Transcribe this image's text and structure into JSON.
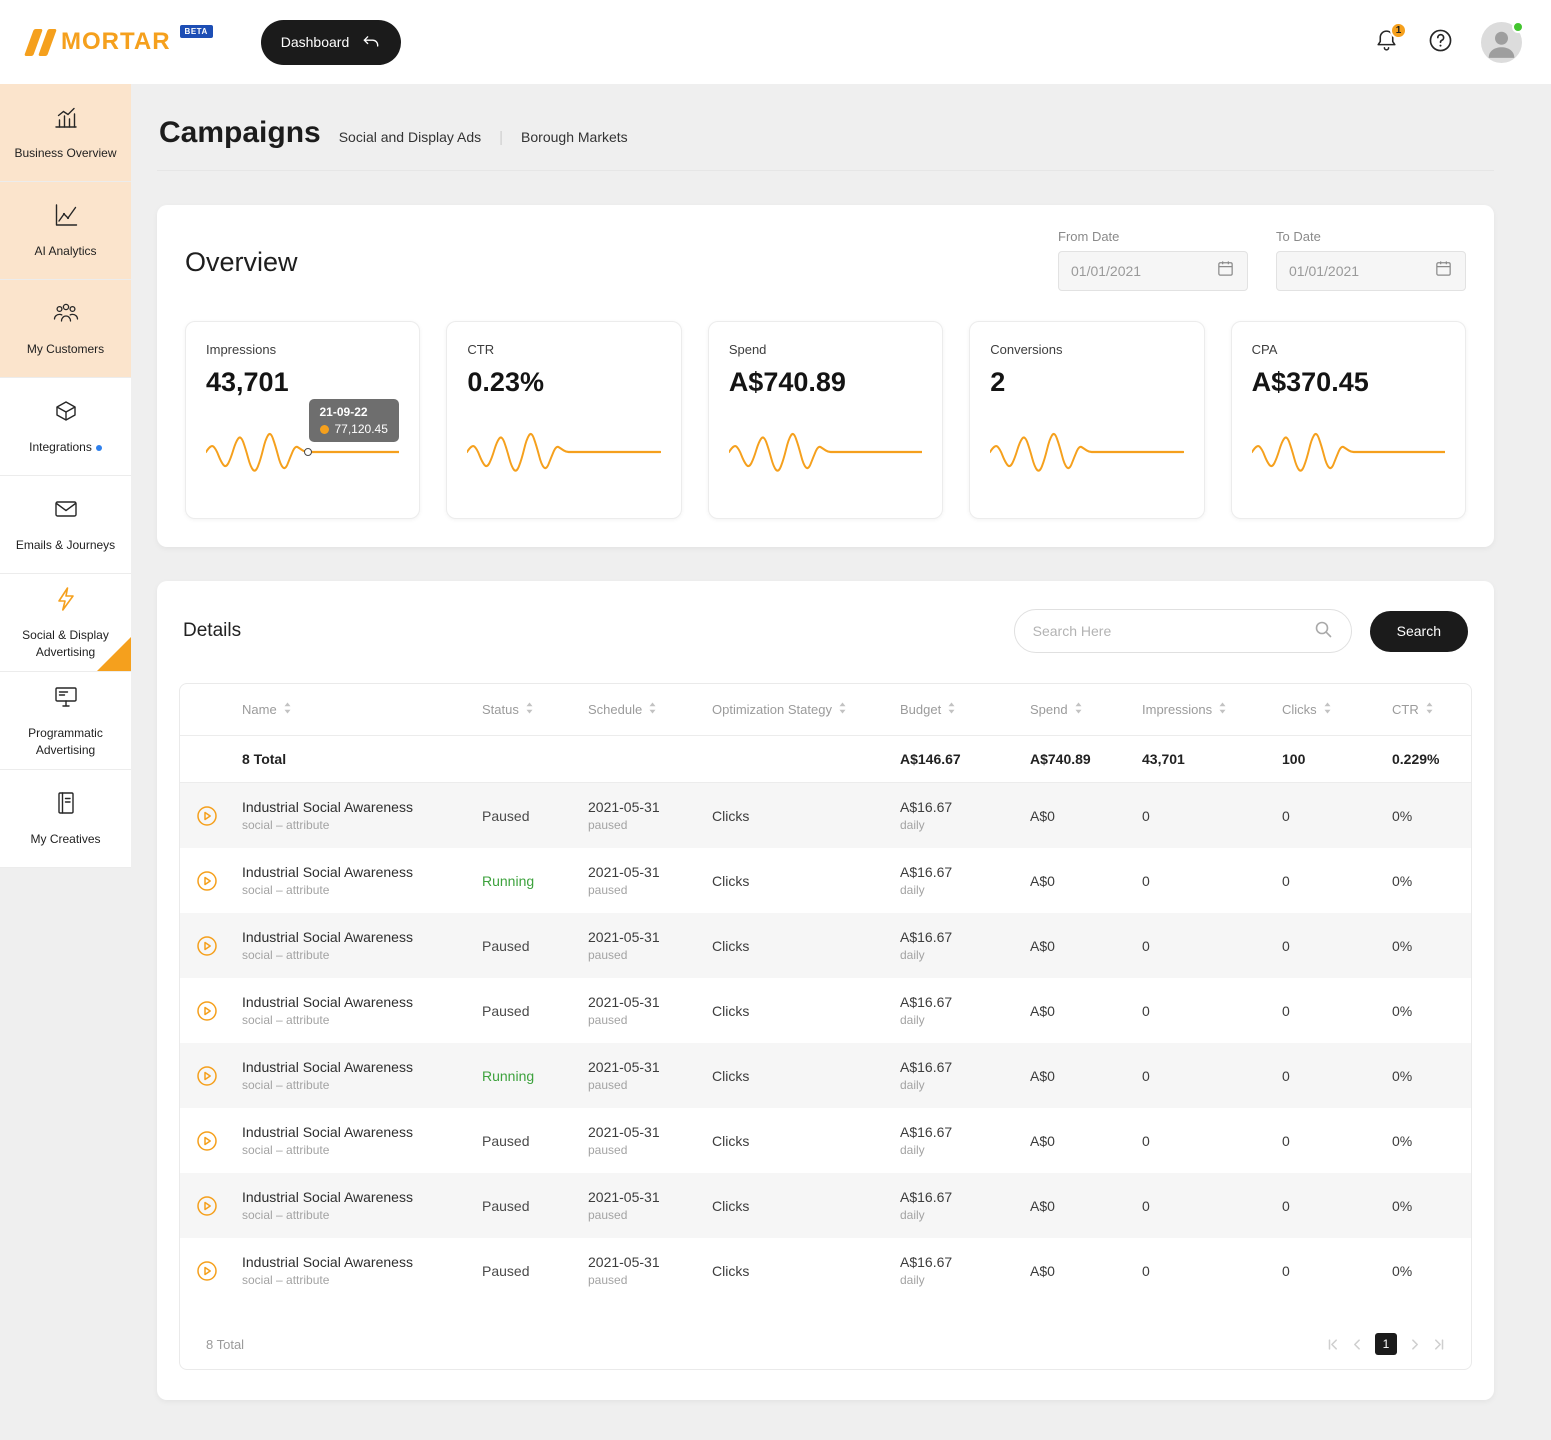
{
  "theme": {
    "accent_orange": "#F5A01D",
    "peach_highlight": "#FBE4CC",
    "beta_blue": "#1D4EB5",
    "running_green": "#3DA23D",
    "page_background": "#EFEFEF",
    "button_black": "#1B1B1B"
  },
  "brand": {
    "name": "MORTAR",
    "beta": "BETA",
    "logo_icon": "mortar-slashes-icon"
  },
  "topbar": {
    "dashboard_label": "Dashboard",
    "dashboard_icon": "reply-arrow-icon",
    "notification_count": "1",
    "icons": [
      "bell-icon",
      "help-icon",
      "avatar"
    ]
  },
  "sidebar": {
    "items": [
      {
        "id": "business-overview",
        "label": "Business Overview",
        "icon": "bar-chart-icon",
        "highlight": true
      },
      {
        "id": "ai-analytics",
        "label": "AI Analytics",
        "icon": "line-chart-icon",
        "highlight": true
      },
      {
        "id": "my-customers",
        "label": "My Customers",
        "icon": "customers-icon",
        "highlight": true
      },
      {
        "id": "integrations",
        "label": "Integrations",
        "icon": "integrations-icon",
        "dot": true
      },
      {
        "id": "emails-journeys",
        "label": "Emails & Journeys",
        "icon": "envelope-icon"
      },
      {
        "id": "social-display-advertising",
        "label": "Social & Display Advertising",
        "icon": "lightning-icon",
        "active": true
      },
      {
        "id": "programmatic-advertising",
        "label": "Programmatic Advertising",
        "icon": "monitor-icon"
      },
      {
        "id": "my-creatives",
        "label": "My Creatives",
        "icon": "notebook-icon"
      }
    ]
  },
  "page": {
    "title": "Campaigns",
    "breadcrumbs": [
      "Social and Display Ads",
      "Borough Markets"
    ]
  },
  "overview": {
    "title": "Overview",
    "from_date": {
      "label": "From Date",
      "value": "01/01/2021"
    },
    "to_date": {
      "label": "To Date",
      "value": "01/01/2021"
    },
    "metrics": [
      {
        "id": "impressions",
        "label": "Impressions",
        "value": "43,701"
      },
      {
        "id": "ctr",
        "label": "CTR",
        "value": "0.23%"
      },
      {
        "id": "spend",
        "label": "Spend",
        "value": "A$740.89"
      },
      {
        "id": "conversions",
        "label": "Conversions",
        "value": "2"
      },
      {
        "id": "cpa",
        "label": "CPA",
        "value": "A$370.45"
      }
    ],
    "tooltip": {
      "date": "21-09-22",
      "value": "77,120.45"
    },
    "sparkline": [
      0.5,
      0.62,
      0.55,
      0.35,
      0.25,
      0.4,
      0.66,
      0.76,
      0.55,
      0.26,
      0.18,
      0.38,
      0.7,
      0.82,
      0.6,
      0.3,
      0.22,
      0.42,
      0.6,
      0.55,
      0.5,
      0.5,
      0.5,
      0.5,
      0.5,
      0.5,
      0.5,
      0.5,
      0.5,
      0.5,
      0.5,
      0.5,
      0.5,
      0.5,
      0.5,
      0.5,
      0.5,
      0.5,
      0.5,
      0.5
    ]
  },
  "details": {
    "title": "Details",
    "search_placeholder": "Search Here",
    "search_button": "Search",
    "table": {
      "columns": [
        "Name",
        "Status",
        "Schedule",
        "Optimization Stategy",
        "Budget",
        "Spend",
        "Impressions",
        "Clicks",
        "CTR"
      ],
      "totals": {
        "label": "8 Total",
        "budget": "A$146.67",
        "spend": "A$740.89",
        "impressions": "43,701",
        "clicks": "100",
        "ctr": "0.229%"
      },
      "rows": [
        {
          "name": "Industrial Social Awareness",
          "subtitle": "social – attribute",
          "status": "Paused",
          "schedule": "2021-05-31",
          "schedule_note": "paused",
          "strategy": "Clicks",
          "budget": "A$16.67",
          "budget_note": "daily",
          "spend": "A$0",
          "impressions": "0",
          "clicks": "0",
          "ctr": "0%"
        },
        {
          "name": "Industrial Social Awareness",
          "subtitle": "social – attribute",
          "status": "Running",
          "schedule": "2021-05-31",
          "schedule_note": "paused",
          "strategy": "Clicks",
          "budget": "A$16.67",
          "budget_note": "daily",
          "spend": "A$0",
          "impressions": "0",
          "clicks": "0",
          "ctr": "0%"
        },
        {
          "name": "Industrial Social Awareness",
          "subtitle": "social – attribute",
          "status": "Paused",
          "schedule": "2021-05-31",
          "schedule_note": "paused",
          "strategy": "Clicks",
          "budget": "A$16.67",
          "budget_note": "daily",
          "spend": "A$0",
          "impressions": "0",
          "clicks": "0",
          "ctr": "0%"
        },
        {
          "name": "Industrial Social Awareness",
          "subtitle": "social – attribute",
          "status": "Paused",
          "schedule": "2021-05-31",
          "schedule_note": "paused",
          "strategy": "Clicks",
          "budget": "A$16.67",
          "budget_note": "daily",
          "spend": "A$0",
          "impressions": "0",
          "clicks": "0",
          "ctr": "0%"
        },
        {
          "name": "Industrial Social Awareness",
          "subtitle": "social – attribute",
          "status": "Running",
          "schedule": "2021-05-31",
          "schedule_note": "paused",
          "strategy": "Clicks",
          "budget": "A$16.67",
          "budget_note": "daily",
          "spend": "A$0",
          "impressions": "0",
          "clicks": "0",
          "ctr": "0%"
        },
        {
          "name": "Industrial Social Awareness",
          "subtitle": "social – attribute",
          "status": "Paused",
          "schedule": "2021-05-31",
          "schedule_note": "paused",
          "strategy": "Clicks",
          "budget": "A$16.67",
          "budget_note": "daily",
          "spend": "A$0",
          "impressions": "0",
          "clicks": "0",
          "ctr": "0%"
        },
        {
          "name": "Industrial Social Awareness",
          "subtitle": "social – attribute",
          "status": "Paused",
          "schedule": "2021-05-31",
          "schedule_note": "paused",
          "strategy": "Clicks",
          "budget": "A$16.67",
          "budget_note": "daily",
          "spend": "A$0",
          "impressions": "0",
          "clicks": "0",
          "ctr": "0%"
        },
        {
          "name": "Industrial Social Awareness",
          "subtitle": "social – attribute",
          "status": "Paused",
          "schedule": "2021-05-31",
          "schedule_note": "paused",
          "strategy": "Clicks",
          "budget": "A$16.67",
          "budget_note": "daily",
          "spend": "A$0",
          "impressions": "0",
          "clicks": "0",
          "ctr": "0%"
        }
      ]
    },
    "footer": {
      "total": "8 Total",
      "page": "1"
    }
  }
}
